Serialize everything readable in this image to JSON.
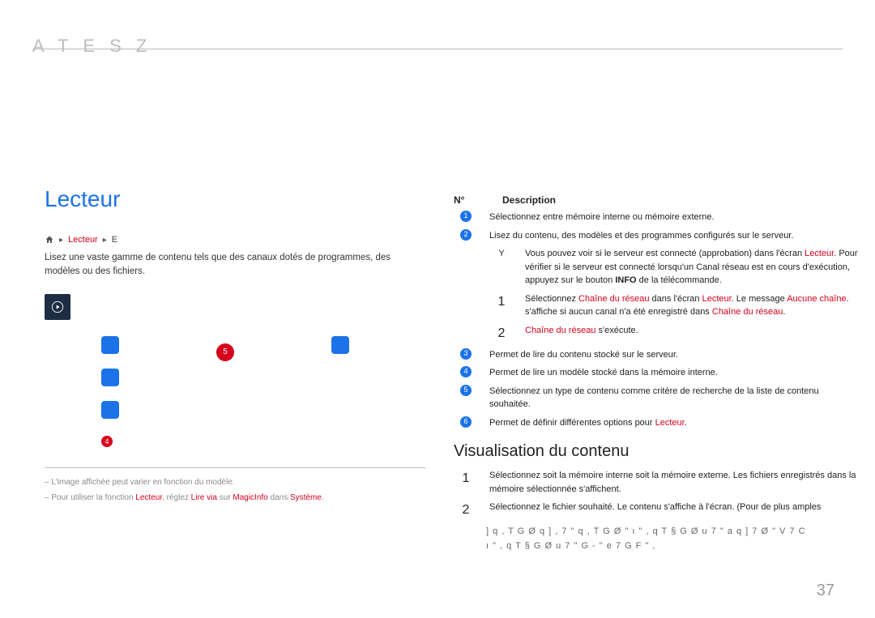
{
  "chapter_glyph": "A  T  E  S    Z",
  "left": {
    "title": "Lecteur",
    "breadcrumb_hl": "Lecteur",
    "breadcrumb_tail": "E",
    "intro": "Lisez une vaste gamme de contenu tels que des canaux dotés de programmes, des modèles ou des fichiers.",
    "badge5": "5",
    "badge4": "4",
    "footnote1_prefix": "–  L'image affichée peut varier en fonction du modèle.",
    "footnote2_prefix": "–  Pour utiliser la fonction ",
    "footnote2_r1": "Lecteur",
    "footnote2_mid1": ", réglez ",
    "footnote2_r2": "Lire via",
    "footnote2_mid2": " sur ",
    "footnote2_r3": "MagicInfo",
    "footnote2_mid3": " dans ",
    "footnote2_r4": "Système",
    "footnote2_end": "."
  },
  "right": {
    "col_no": "N°",
    "col_desc": "Description",
    "r1": "Sélectionnez entre mémoire interne ou mémoire externe.",
    "r2": "Lisez du contenu, des modèles et des programmes configurés sur le serveur.",
    "r2b_pre": "Vous pouvez voir si le serveur est connecté (approbation) dans l'écran ",
    "r2b_hl": "Lecteur",
    "r2b_post": ". Pour vérifier si le serveur est connecté lorsqu'un Canal réseau est en cours d'exécution, appuyez sur le bouton ",
    "r2b_bold": "INFO",
    "r2b_end": " de la télécommande.",
    "step1_pre": "Sélectionnez ",
    "step1_hl1": "Chaîne du réseau",
    "step1_mid1": " dans l'écran ",
    "step1_hl2": "Lecteur",
    "step1_mid2": ". Le message ",
    "step1_hl3": "Aucune chaîne.",
    "step1_mid3": " s'affiche si aucun canal n'a été enregistré dans ",
    "step1_hl4": "Chaîne du réseau",
    "step1_end": ".",
    "step2_hl": "Chaîne du réseau",
    "step2_end": " s'exécute.",
    "r3": "Permet de lire du contenu stocké sur le serveur.",
    "r4": "Permet de lire un modèle stocké dans la mémoire interne.",
    "r5": "Sélectionnez un type de contenu comme critère de recherche de la liste de contenu souhaitée.",
    "r6_pre": "Permet de définir différentes options pour ",
    "r6_hl": "Lecteur",
    "r6_end": ".",
    "h2": "Visualisation du contenu",
    "v1": "Sélectionnez soit la mémoire interne soit la mémoire externe. Les fichiers enregistrés dans la mémoire sélectionnée s'affichent.",
    "v2": "Sélectionnez le fichier souhaité. Le contenu s'affiche à l'écran. (Pour de plus amples",
    "garble1": "]  q , T G Ø  q ]         ,  7 \"       q , T G Ø     \"       ı  \" ,     q T § G Ø   u 7 \"   a    q ]    7 Ø \" V   7 C",
    "garble2": "ı   \" ,       q T § G Ø   u 7 \"    G  -  \"     e 7 G F \" ,"
  },
  "page_number": "37",
  "nums": {
    "n1": "1",
    "n2": "2",
    "n3": "3",
    "n4": "4",
    "n5": "5",
    "n6": "6",
    "big1": "1",
    "big2": "2",
    "Y": "Y"
  }
}
